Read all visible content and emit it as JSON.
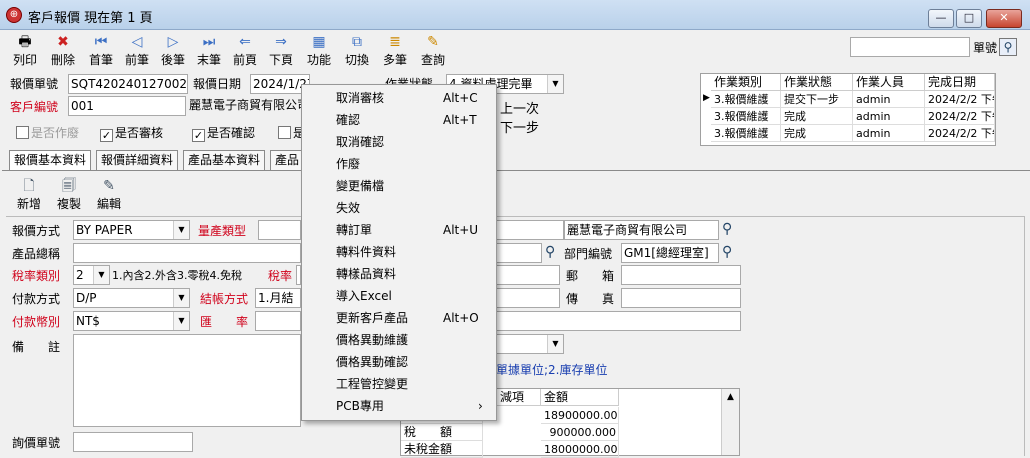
{
  "window": {
    "title": "客戶報價 現在第 1 頁",
    "min": "—",
    "max": "□",
    "close": "✕"
  },
  "toolbar": {
    "items": [
      {
        "label": "列印",
        "icon": "print-icon",
        "glyph": "🖶"
      },
      {
        "label": "刪除",
        "icon": "delete-icon",
        "glyph": "✖"
      },
      {
        "label": "首筆",
        "icon": "first-icon",
        "glyph": "⏮"
      },
      {
        "label": "前筆",
        "icon": "prev-icon",
        "glyph": "◁"
      },
      {
        "label": "後筆",
        "icon": "next-icon",
        "glyph": "▷"
      },
      {
        "label": "末筆",
        "icon": "last-icon",
        "glyph": "⏭"
      },
      {
        "label": "前頁",
        "icon": "prev-page-icon",
        "glyph": "⇐"
      },
      {
        "label": "下頁",
        "icon": "next-page-icon",
        "glyph": "⇒"
      },
      {
        "label": "功能",
        "icon": "function-icon",
        "glyph": "▦"
      },
      {
        "label": "切換",
        "icon": "switch-icon",
        "glyph": "⧉"
      },
      {
        "label": "多筆",
        "icon": "multi-icon",
        "glyph": "≣"
      },
      {
        "label": "查詢",
        "icon": "query-icon",
        "glyph": "✎"
      }
    ],
    "search_value": "",
    "search_label": "單號"
  },
  "header": {
    "quote_no_label": "報價單號",
    "quote_no": "SQT420240127002",
    "quote_date_label": "報價日期",
    "quote_date": "2024/1/27",
    "status_label": "作業狀態",
    "status_value": "4.資料處理完畢",
    "customer_label": "客戶編號",
    "customer_no": "001",
    "customer_name": "麗慧電子商貿有限公司",
    "prev_label": "上一次",
    "next_label": "下一步",
    "voided": "是否作廢",
    "reviewed": "是否審核",
    "confirmed": "是否確認",
    "other": "是"
  },
  "history": {
    "columns": [
      "作業類別",
      "作業狀態",
      "作業人員",
      "完成日期"
    ],
    "rows": [
      [
        "3.報價維護",
        "提交下一步",
        "admin",
        "2024/2/2 下午"
      ],
      [
        "3.報價維護",
        "完成",
        "admin",
        "2024/2/2 下午"
      ],
      [
        "3.報價維護",
        "完成",
        "admin",
        "2024/2/2 下午"
      ]
    ]
  },
  "tabs": [
    "報價基本資料",
    "報價詳細資料",
    "產品基本資料",
    "產品"
  ],
  "subtoolbar": [
    "新增",
    "複製",
    "編輯"
  ],
  "form": {
    "quote_method_label": "報價方式",
    "quote_method": "BY PAPER",
    "prod_type_label": "量產類型",
    "product_name_label": "產品總稱",
    "tax_type_label": "稅率類別",
    "tax_type": "2",
    "tax_hint": "1.內含2.外含3.零稅4.免稅",
    "tax_rate_label": "稅率",
    "pay_method_label": "付款方式",
    "pay_method": "D/P",
    "settle_label": "結帳方式",
    "settle_value": "1.月結",
    "currency_label": "付款幣別",
    "currency": "NT$",
    "exrate_label": "匯　　率",
    "note_label": "備　　註",
    "inquiry_label": "詢價單號",
    "company_name": "麗慧電子商貿有限公司",
    "dept_label": "部門編號",
    "dept_value": "GM1[總經理室]",
    "postal_label": "郵　　箱",
    "fax_label": "傳　　真",
    "unit_hint": "單據單位;2.庫存單位"
  },
  "summary": {
    "columns": [
      "減項",
      "金額"
    ],
    "rows": [
      {
        "label": "",
        "value": "18900000.000"
      },
      {
        "label": "稅　　額",
        "value": "900000.000"
      },
      {
        "label": "未稅金額",
        "value": "18000000.000"
      }
    ]
  },
  "context_menu": [
    {
      "label": "取消審核",
      "shortcut": "Alt+C"
    },
    {
      "label": "確認",
      "shortcut": "Alt+T"
    },
    {
      "label": "取消確認",
      "shortcut": ""
    },
    {
      "label": "作廢",
      "shortcut": ""
    },
    {
      "label": "變更備檔",
      "shortcut": ""
    },
    {
      "label": "失效",
      "shortcut": ""
    },
    {
      "label": "轉訂單",
      "shortcut": "Alt+U"
    },
    {
      "label": "轉料件資料",
      "shortcut": ""
    },
    {
      "label": "轉樣品資料",
      "shortcut": ""
    },
    {
      "label": "導入Excel",
      "shortcut": ""
    },
    {
      "label": "更新客戶產品",
      "shortcut": "Alt+O"
    },
    {
      "label": "價格異動維護",
      "shortcut": ""
    },
    {
      "label": "價格異動確認",
      "shortcut": ""
    },
    {
      "label": "工程管控變更",
      "shortcut": ""
    },
    {
      "label": "PCB專用",
      "shortcut": "›"
    }
  ]
}
